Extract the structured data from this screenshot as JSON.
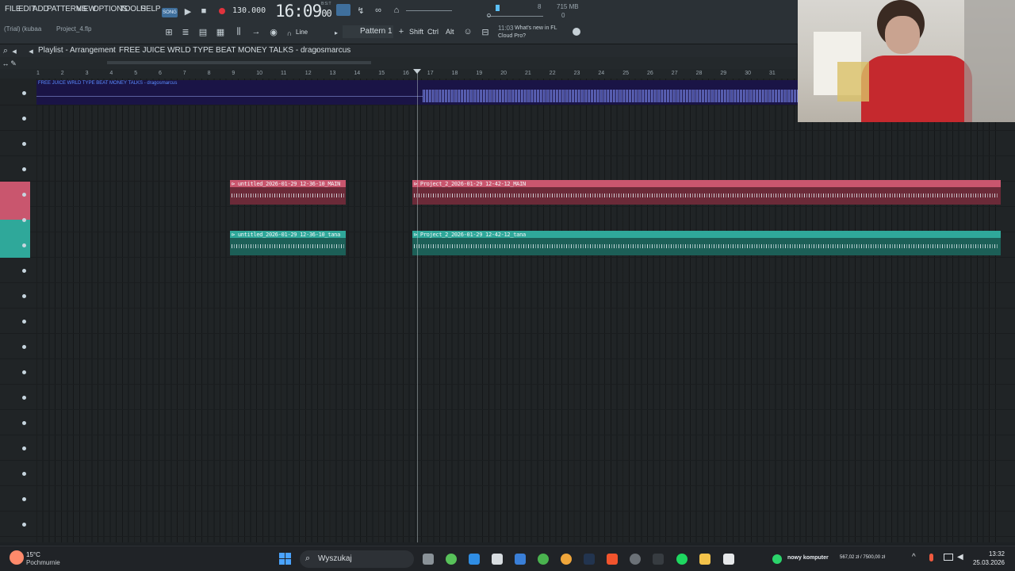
{
  "menu": [
    "FILE",
    "EDIT",
    "ADD",
    "PATTERNS",
    "VIEW",
    "OPTIONS",
    "TOOLS",
    "HELP"
  ],
  "transport": {
    "mode": "SONG",
    "tempo": "130.000",
    "time": "16:09",
    "time_sub": "00",
    "time_unit": "B:S:T"
  },
  "toolbar": {
    "trial": "(Trial) (kubaa",
    "project": "Project_4.flp",
    "snap": "Line",
    "pattern": "Pattern 1",
    "shift": "Shift",
    "ctrl": "Ctrl",
    "alt": "Alt",
    "news_time": "11:03",
    "news": "What's new in FL Cloud Pro?",
    "cpu": "8",
    "mem": "715 MB",
    "poly": "0"
  },
  "playlist": {
    "breadcrumb_1": "Playlist - Arrangement",
    "breadcrumb_2": "FREE JUICE WRLD TYPE BEAT MONEY TALKS - dragosmarcus",
    "ruler": [
      "1",
      "2",
      "3",
      "4",
      "5",
      "6",
      "7",
      "8",
      "9",
      "10",
      "11",
      "12",
      "13",
      "14",
      "15",
      "16",
      "17",
      "18",
      "19",
      "20",
      "21",
      "22",
      "23",
      "24",
      "25",
      "26",
      "27",
      "28",
      "29",
      "30",
      "31"
    ],
    "audio_track_title": "FREE JUICE WRLD TYPE BEAT MONEY TALKS - dragosmarcus"
  },
  "clips": [
    {
      "title": "untitled_2026-01-29 12-36-10_MAIN",
      "track": 4,
      "color": "#c9566e"
    },
    {
      "title": "Project_2_2026-01-29 12-42-12_MAIN",
      "track": 4,
      "color": "#c9566e"
    },
    {
      "title": "untitled_2026-01-29 12-36-10_tana",
      "track": 6,
      "color": "#2fa89a"
    },
    {
      "title": "Project_2_2026-01-29 12-42-12_tana",
      "track": 6,
      "color": "#2fa89a"
    }
  ],
  "taskbar": {
    "weather_temp": "15°C",
    "weather_text": "Pochmurnie",
    "search": "Wyszukaj",
    "notif_title": "nowy komputer",
    "notif_value": "567,02 zł / 7500,00 zł",
    "clock_time": "13:32",
    "clock_date": "25.03.2026"
  },
  "colors": {
    "accent": "#4aa3ff",
    "clip_red": "#c9566e",
    "clip_teal": "#2fa89a",
    "record": "#e0333d"
  }
}
